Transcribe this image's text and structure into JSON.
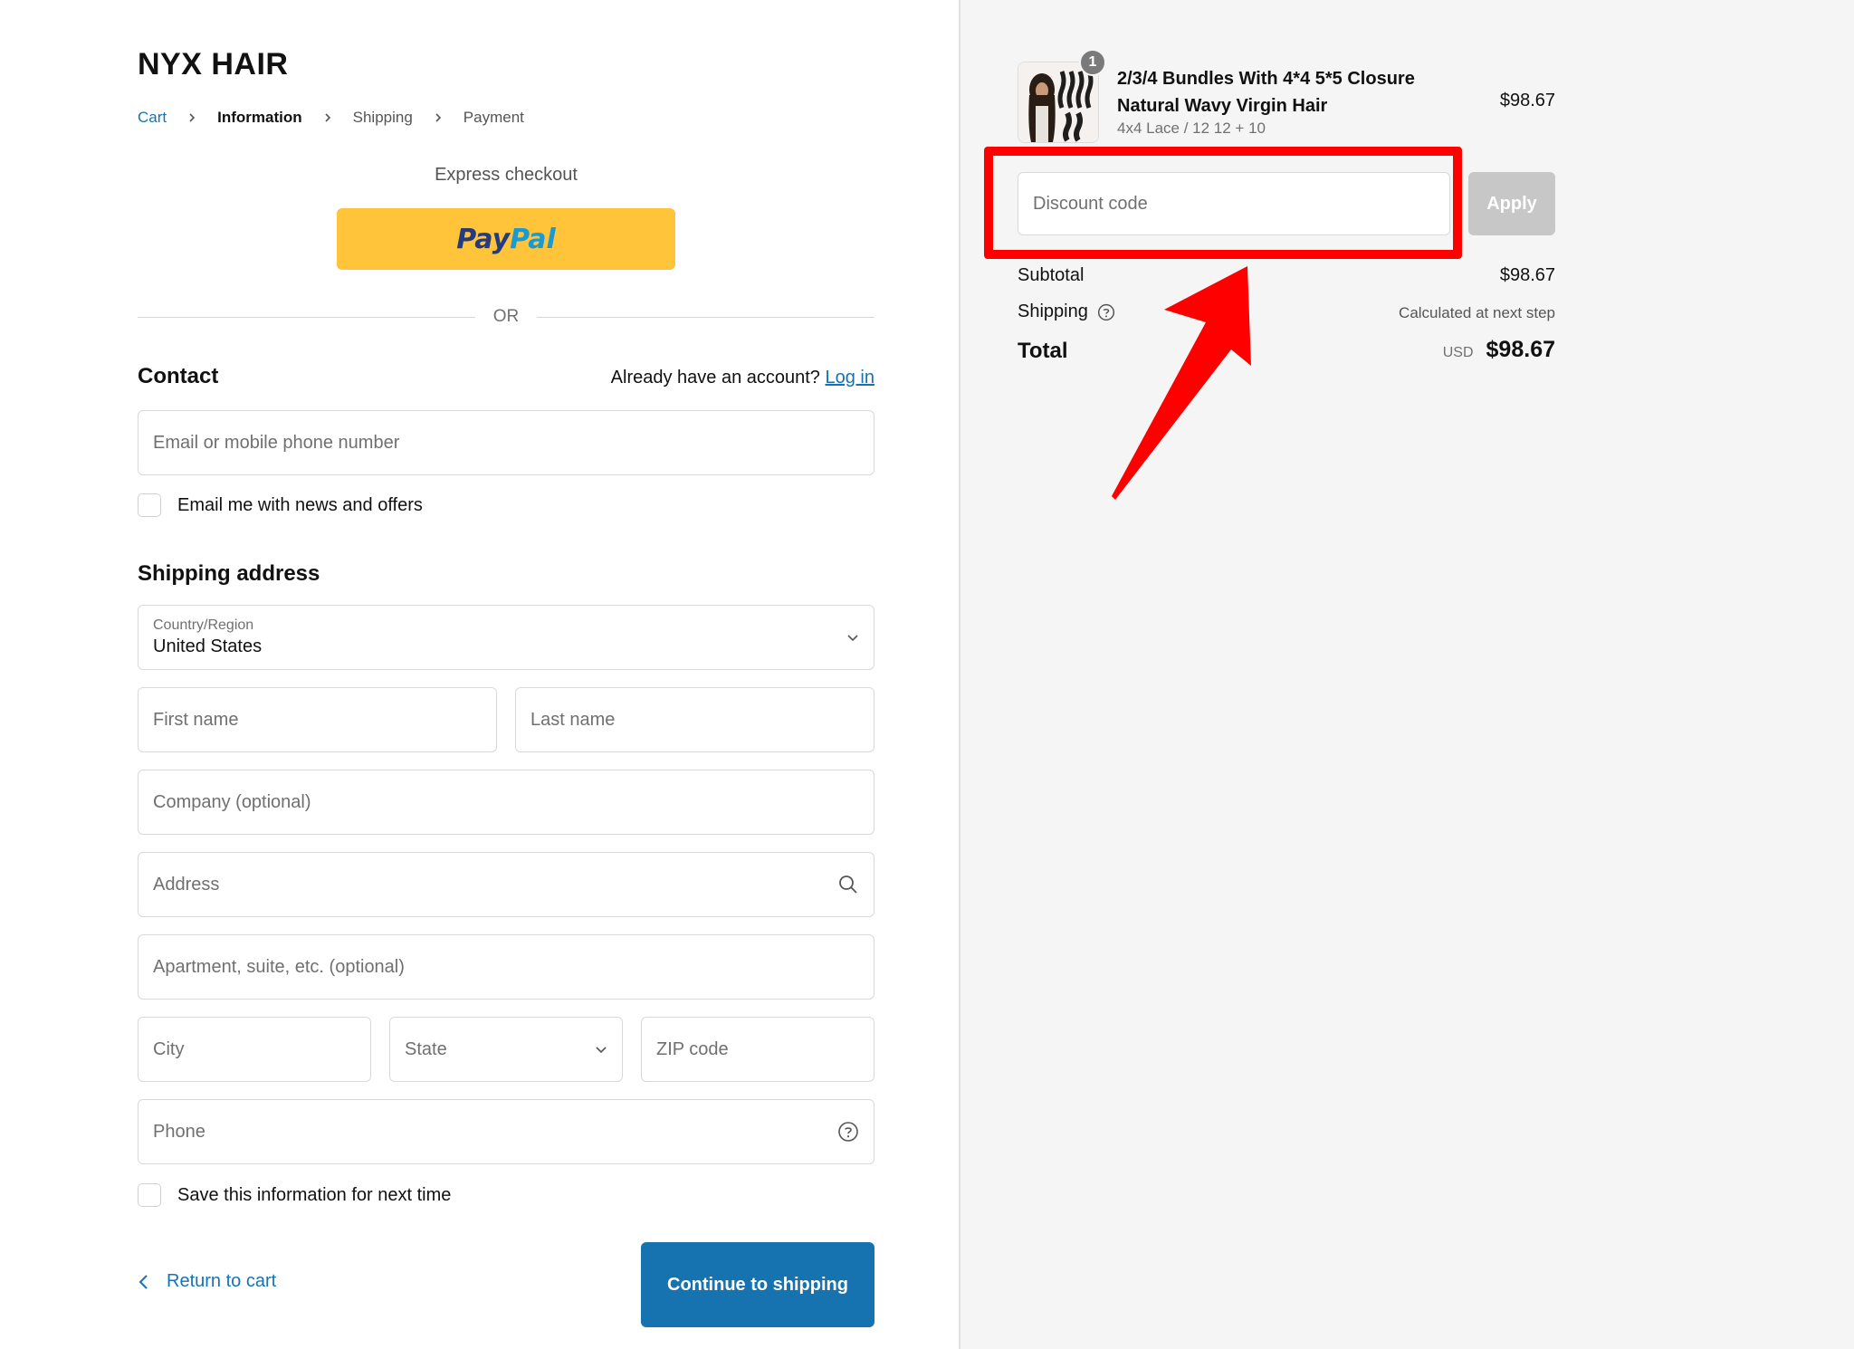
{
  "brand": "NYX HAIR",
  "breadcrumb": [
    "Cart",
    "Information",
    "Shipping",
    "Payment"
  ],
  "express_checkout": {
    "label": "Express checkout",
    "paypal_part1": "Pay",
    "paypal_part2": "Pal",
    "paypal_color": "#ffc439"
  },
  "divider_or": "OR",
  "contact": {
    "heading": "Contact",
    "account_prompt": "Already have an account?",
    "login_link": "Log in",
    "email_placeholder": "Email or mobile phone number",
    "newsletter_label": "Email me with news and offers"
  },
  "shipping_address": {
    "heading": "Shipping address",
    "country_label": "Country/Region",
    "country_value": "United States",
    "first_name": "First name",
    "last_name": "Last name",
    "company": "Company (optional)",
    "address": "Address",
    "apartment": "Apartment, suite, etc. (optional)",
    "city": "City",
    "state": "State",
    "zip": "ZIP code",
    "phone": "Phone",
    "save_info_label": "Save this information for next time"
  },
  "actions": {
    "return_label": "Return to cart",
    "continue_label": "Continue to shipping",
    "accent_color": "#1773b0"
  },
  "order": {
    "quantity": "1",
    "product_title": "2/3/4 Bundles With 4*4 5*5 Closure Natural Wavy Virgin Hair",
    "variant": "4x4 Lace / 12 12 + 10",
    "price": "$98.67",
    "discount_placeholder": "Discount code",
    "apply_label": "Apply",
    "subtotal_label": "Subtotal",
    "subtotal_value": "$98.67",
    "shipping_label": "Shipping",
    "shipping_value": "Calculated at next step",
    "total_label": "Total",
    "total_currency": "USD",
    "total_value": "$98.67"
  },
  "annotation": {
    "highlight_color": "#ff0000"
  }
}
